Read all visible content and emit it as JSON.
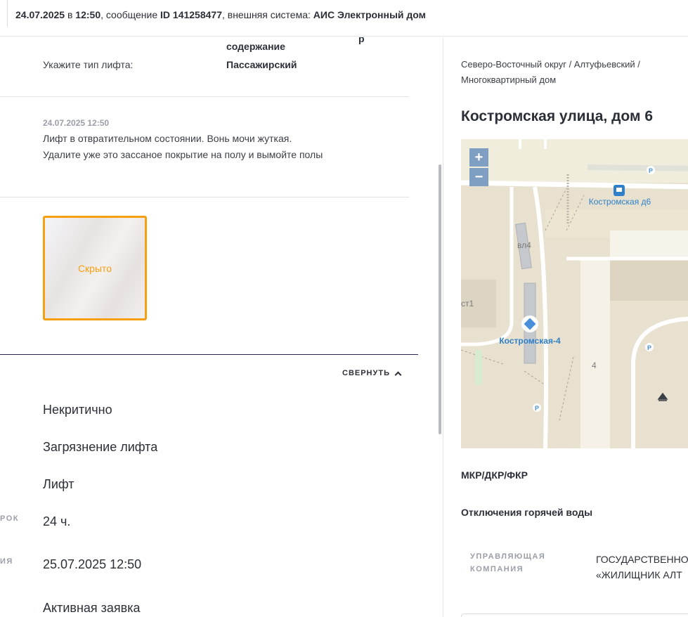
{
  "header": {
    "date": "24.07.2025",
    "in_word": " в ",
    "time": "12:50",
    "msg_prefix": ", сообщение ",
    "msg_id": "ID 141258477",
    "ext_prefix": ", внешняя система: ",
    "ext_system": "АИС Электронный дом"
  },
  "details": {
    "top_fragment": "р",
    "top_value": "содержание",
    "lift_type_label": "Укажите тип лифта:",
    "lift_type_value": "Пассажирский"
  },
  "comment": {
    "date": "24.07.2025 12:50",
    "text": "Лифт в отвратительном состоянии. Вонь мочи жуткая. Удалите уже это зассаное покрытие на полу и вымойте полы"
  },
  "photo": {
    "hidden_label": "Скрыто"
  },
  "collapse_label": "СВЕРНУТЬ",
  "info_rows": [
    {
      "label": "",
      "value": "Некритично"
    },
    {
      "label": "",
      "value": "Загрязнение лифта"
    },
    {
      "label": "",
      "value": "Лифт"
    },
    {
      "label": "РОК",
      "value": "24 ч."
    },
    {
      "label": "ИЯ",
      "value": "25.07.2025 12:50"
    },
    {
      "label": "",
      "value": "Активная заявка"
    }
  ],
  "location": {
    "breadcrumbs": "Северо-Восточный округ / Алтуфьевский / Многоквартирный дом",
    "address": "Костромская улица, дом 6"
  },
  "map": {
    "zoom_in": "+",
    "zoom_out": "−",
    "bus_stop": "Костромская д6",
    "place": "Костромская-4",
    "lbl_vl4": "вл4",
    "lbl_st1": "ст1",
    "lbl_4": "4",
    "parking": "P",
    "colors": {
      "road": "#ffffff",
      "block": "#f1eddd",
      "building": "#c5c8cc",
      "water": "#9bb0c9",
      "accent": "#2f7fc9"
    }
  },
  "sections": {
    "repair": "МКР/ДКР/ФКР",
    "hot_water": "Отключения горячей воды"
  },
  "management": {
    "label": "УПРАВЛЯЮЩАЯ КОМПАНИЯ",
    "value_line1": "ГОСУДАРСТВЕННОЕ",
    "value_line2": "«ЖИЛИЩНИК АЛТ"
  }
}
